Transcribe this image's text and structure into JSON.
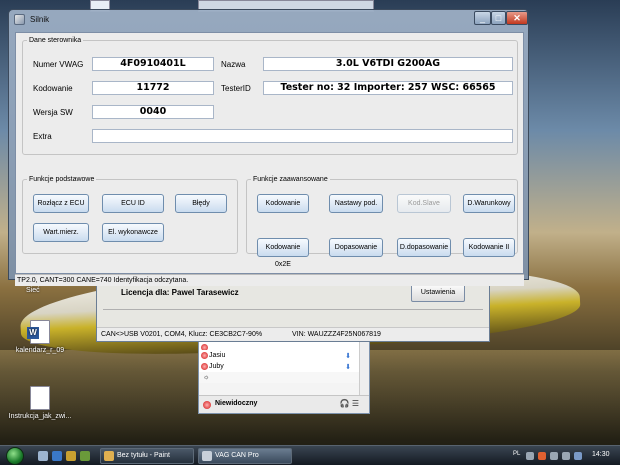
{
  "main_window": {
    "title": "Silnik",
    "controls": {
      "minimize": "_",
      "maximize": "□",
      "close": "✕"
    },
    "dane": {
      "legend": "Dane sterownika",
      "numer_label": "Numer VWAG",
      "numer_value": "4F0910401L",
      "nazwa_label": "Nazwa",
      "nazwa_value": "3.0L V6TDI  G200AG",
      "kodowanie_label": "Kodowanie",
      "kodowanie_value": "11772",
      "tester_label": "TesterID",
      "tester_value": "Tester no: 32 Importer: 257 WSC: 66565",
      "wersja_label": "Wersja SW",
      "wersja_value": "0040",
      "extra_label": "Extra",
      "extra_value": ""
    },
    "podstawowe": {
      "legend": "Funkcje podstawowe",
      "buttons": [
        "Rozłącz z ECU",
        "ECU ID",
        "Błędy",
        "Wart.mierz.",
        "El. wykonawcze"
      ]
    },
    "zaawansowane": {
      "legend": "Funkcje zaawansowane",
      "buttons": [
        "Kodowanie",
        "Nastawy pod.",
        "Kod.Slave",
        "D.Warunkowy",
        "Kodowanie 0x2E",
        "Dopasowanie",
        "D.dopasowanie",
        "Kodowanie II"
      ]
    },
    "status": "TP2.0, CANT=300 CANE=740   Identyfikacja odczytana."
  },
  "background_window": {
    "license": "Licencja dla: Pawel Tarasewicz",
    "settings_button": "Ustawienia",
    "status_connection": "CAN<>USB V0201, COM4, Klucz: CE3CB2C7-90%",
    "status_vin": "VIN: WAUZZZ4F25N067819"
  },
  "messenger": {
    "contacts": [
      "Jasiu",
      "Juby"
    ],
    "status": "Niewidoczny"
  },
  "desktop": {
    "icons": [
      "kalendarz_r_09",
      "Instrukcja_jak_zwi..."
    ],
    "snippet": "Sieć"
  },
  "taskbar": {
    "tasks": [
      "Bez tytułu - Paint",
      "VAG CAN Pro"
    ],
    "language": "PL",
    "clock": "14:30"
  },
  "colors": {
    "title_gradient_top": "#9caec4",
    "button_border": "#6f8dad",
    "close_button": "#c2381e"
  }
}
